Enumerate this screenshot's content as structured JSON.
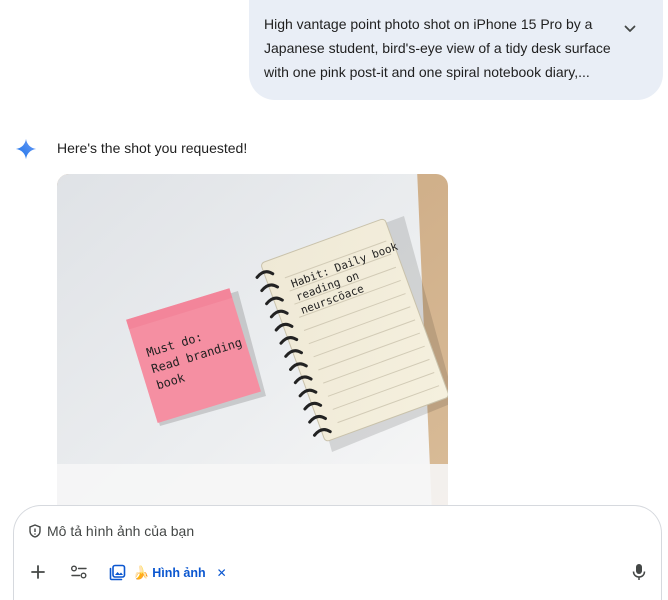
{
  "prompt": {
    "lines": [
      "High vantage point photo shot on iPhone 15 Pro by a",
      "Japanese student, bird's-eye view of a tidy desk surface",
      "with one pink post-it and one spiral notebook diary,..."
    ]
  },
  "response": {
    "text": "Here's the shot you requested!",
    "image": {
      "postit_lines": [
        "Must do:",
        "Read branding",
        "book"
      ],
      "notebook_lines": [
        "Habit: Daily book",
        "reading on",
        "neurscöace"
      ]
    }
  },
  "composer": {
    "placeholder": "Mô tả hình ảnh của bạn",
    "chip_emoji": "🍌",
    "chip_label": "Hình ảnh",
    "chip_close": "✕"
  },
  "colors": {
    "bubble": "#e9eef6",
    "accent": "#0b57d0",
    "postit": "#f58fa2"
  },
  "icons": [
    "chevron-down-icon",
    "gemini-sparkle-icon",
    "shield-icon",
    "plus-icon",
    "tune-icon",
    "image-gallery-icon",
    "microphone-icon"
  ]
}
